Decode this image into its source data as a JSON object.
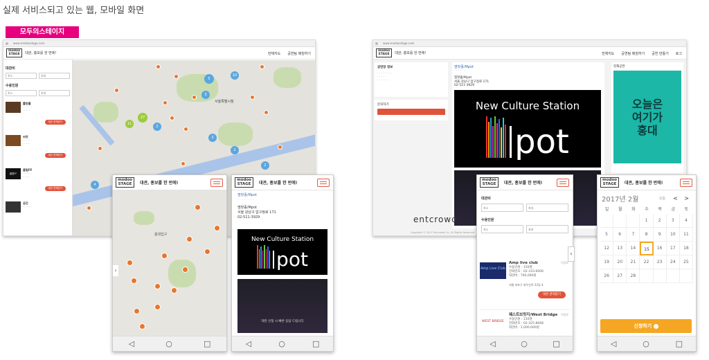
{
  "page_title": "실제 서비스되고 있는 웹, 모바일 화면",
  "brand_banner": "모두의스테이지",
  "logo_line1": "modoo",
  "logo_line2": "STAGE",
  "tagline": "대관, 홍보를 한 번에!",
  "web1": {
    "url": "www.modoostage.com",
    "nav": [
      "전체지도",
      "공연팀 매칭하기"
    ],
    "filter_labels": [
      "대관비",
      "수용인원"
    ],
    "select_min": "최소",
    "select_max": "최대",
    "venue_btn": "대관 견적받기",
    "venues": [
      {
        "name": "롤링홀",
        "thumb": ""
      },
      {
        "name": "씨앗",
        "thumb": ""
      },
      {
        "name": "클럽FF",
        "thumb": "클럽FF"
      },
      {
        "name": "공간",
        "thumb": ""
      }
    ],
    "map_label": "서울특별시청"
  },
  "web2": {
    "url": "www.modoostage.com",
    "nav": [
      "전체지도",
      "공연팀 매칭하기",
      "공연 만들기",
      "로그"
    ],
    "left_title": "공연장 정보",
    "left_sub": "문의하기",
    "venue_name": "엠팟홀/Mpot",
    "venue_addr1": "서울 강남구 압구정로 171",
    "venue_phone": "02-511-3929",
    "right_title": "현재공연",
    "poster_text": "오늘은 여기가 홍대",
    "footer_logo": "entcrowd",
    "copyright": "Copyright © 2017 Entcrowd Co., All Rights Reserved"
  },
  "mpot_title": "New Culture Station",
  "mpot_word": "pot",
  "phone_map": {
    "map_area": "홍대입구"
  },
  "phone_venue": {
    "name": "엠팟홀/Mpot",
    "addr": "서울 강남구 압구정로 171",
    "phone": "02-511-3929",
    "photo_caption": "대관 신청 시 빠른 응답 드립니다"
  },
  "phone_list": {
    "filter_labels": [
      "대관비",
      "수용인원"
    ],
    "select_min": "최소",
    "select_max": "최대",
    "venues": [
      {
        "name": "Amp live club",
        "thumb": "Amp Live Club",
        "lines": [
          "수용인원 : 150명",
          "전화번호 : 02-333-6006",
          "대관비 : 700,000원"
        ],
        "addr": "서울 마포구 와우산로 22길 4",
        "tag": "이용료",
        "btn": "대관 견적받기"
      },
      {
        "name": "웨스트브릿지/West Bridge",
        "thumb": "WEST BRIDGE",
        "lines": [
          "수용인원 : 150명",
          "전화번호 : 02-325-8668",
          "대관비 : 1,000,000원"
        ],
        "tag": "이용료"
      }
    ]
  },
  "phone_cal": {
    "month": "2017년 2월",
    "today_label": "오늘",
    "prev": "<",
    "next": ">",
    "weekdays": [
      "일",
      "월",
      "화",
      "수",
      "목",
      "금",
      "토"
    ],
    "days": [
      "",
      "",
      "",
      "1",
      "2",
      "3",
      "4",
      "5",
      "6",
      "7",
      "8",
      "9",
      "10",
      "11",
      "12",
      "13",
      "14",
      "15",
      "16",
      "17",
      "18",
      "19",
      "20",
      "21",
      "22",
      "23",
      "24",
      "25",
      "26",
      "27",
      "28",
      "",
      "",
      "",
      ""
    ],
    "selected_day": "15",
    "submit": "신청하기"
  },
  "softkeys": [
    "◁",
    "○",
    "□"
  ],
  "colors": {
    "accent": "#e0533b",
    "pin": "#e8762e",
    "orange": "#f5a623",
    "banner": "#e6007e"
  }
}
